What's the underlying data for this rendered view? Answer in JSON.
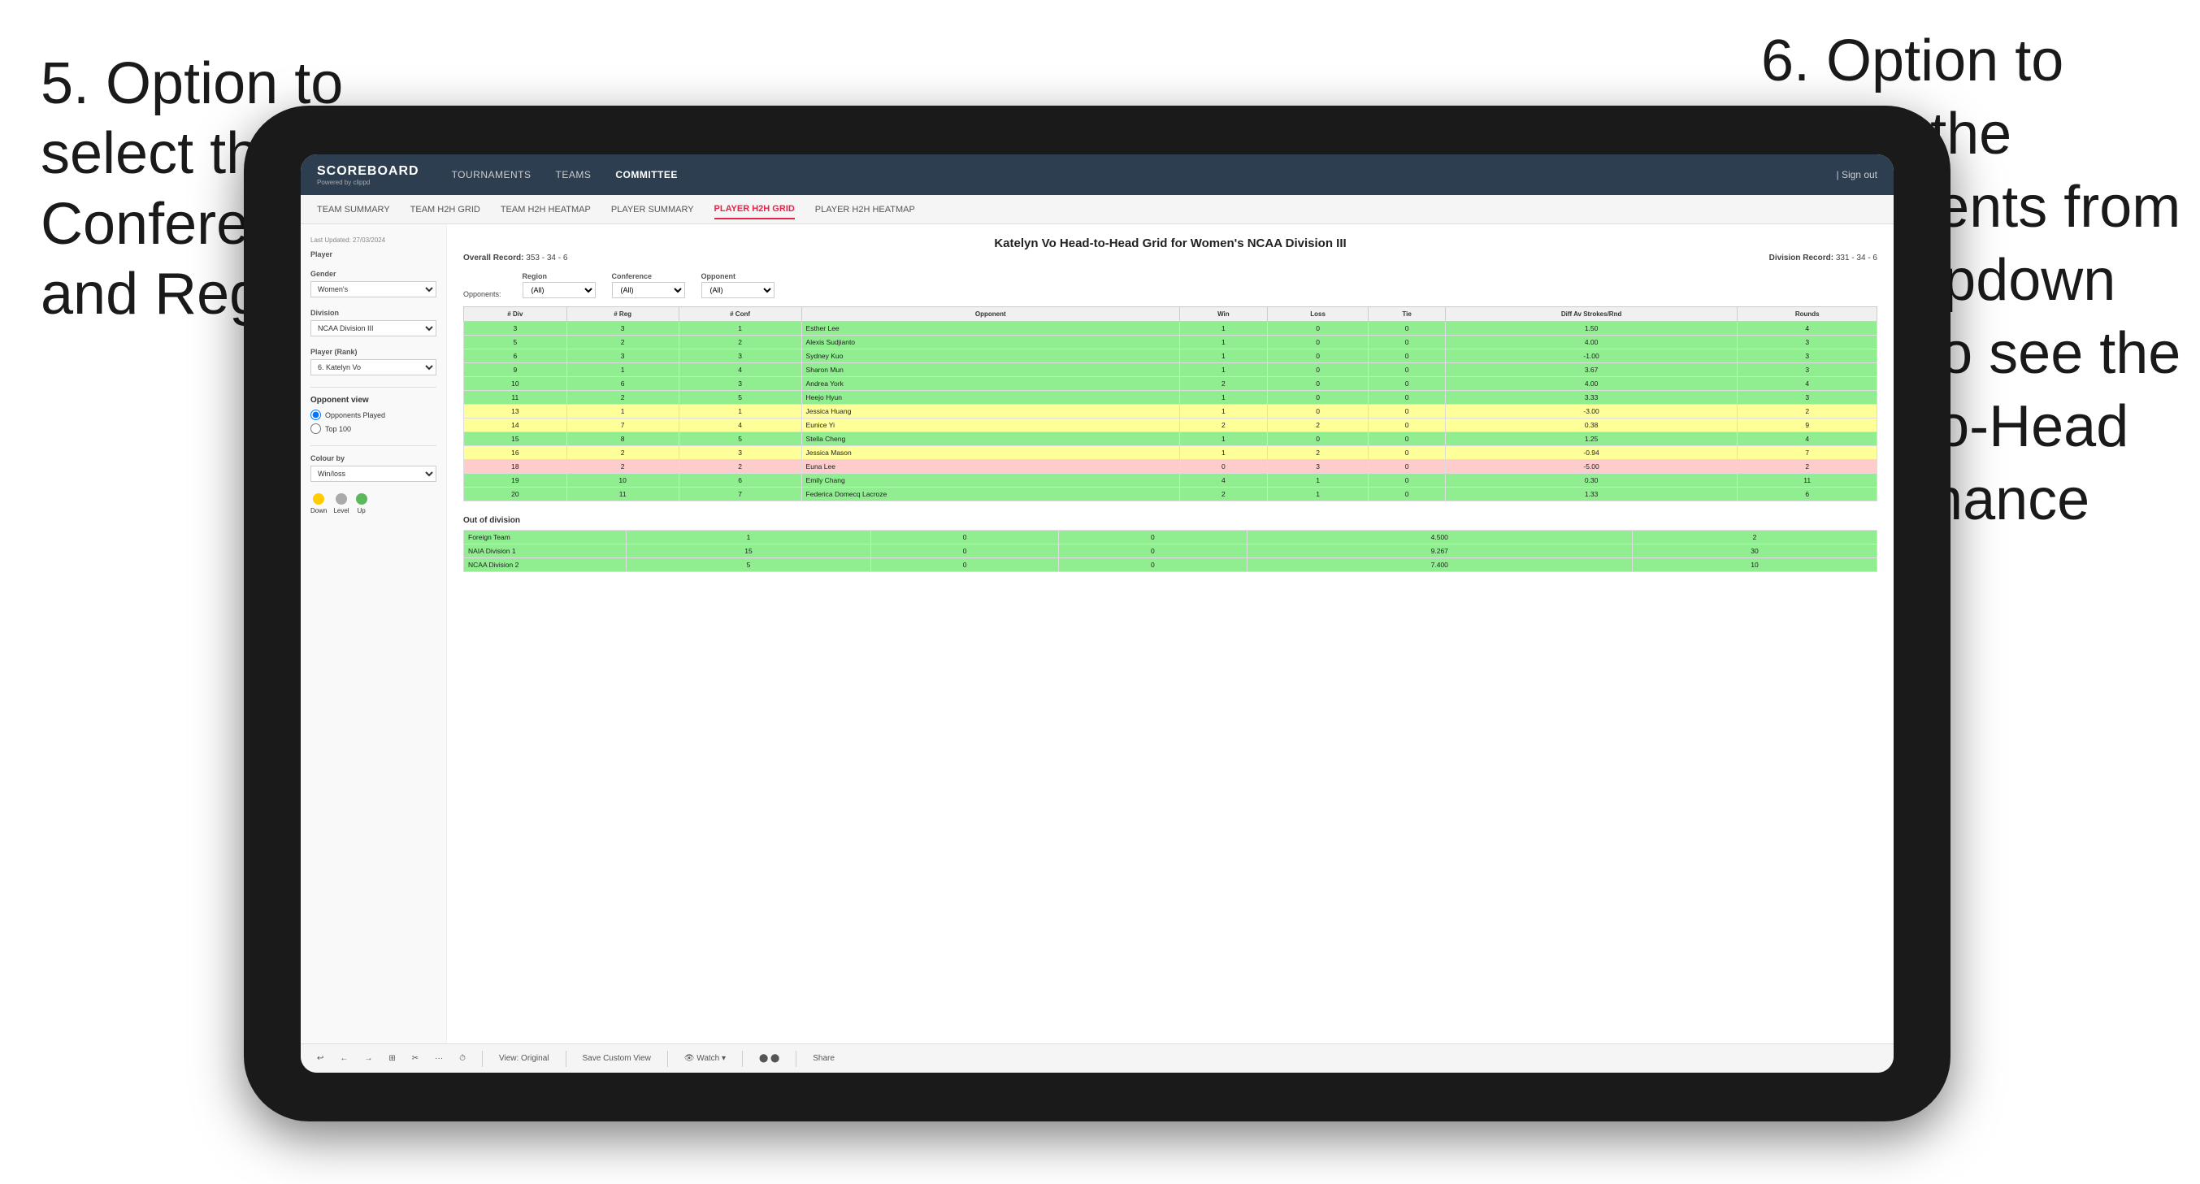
{
  "annotations": {
    "left": {
      "text": "5. Option to select the Conference and Region"
    },
    "right": {
      "text": "6. Option to select the Opponents from the dropdown menu to see the Head-to-Head performance"
    }
  },
  "nav": {
    "logo": "SCOREBOARD",
    "logo_sub": "Powered by clippd",
    "items": [
      "TOURNAMENTS",
      "TEAMS",
      "COMMITTEE"
    ],
    "active_item": "COMMITTEE",
    "sign_out": "| Sign out"
  },
  "sub_nav": {
    "items": [
      "TEAM SUMMARY",
      "TEAM H2H GRID",
      "TEAM H2H HEATMAP",
      "PLAYER SUMMARY",
      "PLAYER H2H GRID",
      "PLAYER H2H HEATMAP"
    ],
    "active": "PLAYER H2H GRID"
  },
  "left_panel": {
    "last_updated": "Last Updated: 27/03/2024",
    "player_label": "Player",
    "gender_label": "Gender",
    "gender_value": "Women's",
    "division_label": "Division",
    "division_value": "NCAA Division III",
    "player_rank_label": "Player (Rank)",
    "player_rank_value": "6. Katelyn Vo",
    "opponent_view_label": "Opponent view",
    "opponent_view_options": [
      "Opponents Played",
      "Top 100"
    ],
    "colour_by_label": "Colour by",
    "colour_by_value": "Win/loss",
    "legend_down": "Down",
    "legend_level": "Level",
    "legend_up": "Up"
  },
  "main": {
    "title": "Katelyn Vo Head-to-Head Grid for Women's NCAA Division III",
    "overall_record_label": "Overall Record:",
    "overall_record": "353 - 34 - 6",
    "division_record_label": "Division Record:",
    "division_record": "331 - 34 - 6",
    "filters": {
      "opponents_label": "Opponents:",
      "region_label": "Region",
      "region_value": "(All)",
      "conference_label": "Conference",
      "conference_value": "(All)",
      "opponent_label": "Opponent",
      "opponent_value": "(All)"
    },
    "table_headers": [
      "# Div",
      "# Reg",
      "# Conf",
      "Opponent",
      "Win",
      "Loss",
      "Tie",
      "Diff Av Strokes/Rnd",
      "Rounds"
    ],
    "table_rows": [
      {
        "div": 3,
        "reg": 3,
        "conf": 1,
        "opponent": "Esther Lee",
        "win": 1,
        "loss": 0,
        "tie": 0,
        "diff": 1.5,
        "rounds": 4,
        "color": "green"
      },
      {
        "div": 5,
        "reg": 2,
        "conf": 2,
        "opponent": "Alexis Sudjianto",
        "win": 1,
        "loss": 0,
        "tie": 0,
        "diff": 4.0,
        "rounds": 3,
        "color": "green"
      },
      {
        "div": 6,
        "reg": 3,
        "conf": 3,
        "opponent": "Sydney Kuo",
        "win": 1,
        "loss": 0,
        "tie": 0,
        "diff": -1.0,
        "rounds": 3,
        "color": "green"
      },
      {
        "div": 9,
        "reg": 1,
        "conf": 4,
        "opponent": "Sharon Mun",
        "win": 1,
        "loss": 0,
        "tie": 0,
        "diff": 3.67,
        "rounds": 3,
        "color": "green"
      },
      {
        "div": 10,
        "reg": 6,
        "conf": 3,
        "opponent": "Andrea York",
        "win": 2,
        "loss": 0,
        "tie": 0,
        "diff": 4.0,
        "rounds": 4,
        "color": "green"
      },
      {
        "div": 11,
        "reg": 2,
        "conf": 5,
        "opponent": "Heejo Hyun",
        "win": 1,
        "loss": 0,
        "tie": 0,
        "diff": 3.33,
        "rounds": 3,
        "color": "green"
      },
      {
        "div": 13,
        "reg": 1,
        "conf": 1,
        "opponent": "Jessica Huang",
        "win": 1,
        "loss": 0,
        "tie": 0,
        "diff": -3.0,
        "rounds": 2,
        "color": "yellow"
      },
      {
        "div": 14,
        "reg": 7,
        "conf": 4,
        "opponent": "Eunice Yi",
        "win": 2,
        "loss": 2,
        "tie": 0,
        "diff": 0.38,
        "rounds": 9,
        "color": "yellow"
      },
      {
        "div": 15,
        "reg": 8,
        "conf": 5,
        "opponent": "Stella Cheng",
        "win": 1,
        "loss": 0,
        "tie": 0,
        "diff": 1.25,
        "rounds": 4,
        "color": "green"
      },
      {
        "div": 16,
        "reg": 2,
        "conf": 3,
        "opponent": "Jessica Mason",
        "win": 1,
        "loss": 2,
        "tie": 0,
        "diff": -0.94,
        "rounds": 7,
        "color": "yellow"
      },
      {
        "div": 18,
        "reg": 2,
        "conf": 2,
        "opponent": "Euna Lee",
        "win": 0,
        "loss": 3,
        "tie": 0,
        "diff": -5.0,
        "rounds": 2,
        "color": "red"
      },
      {
        "div": 19,
        "reg": 10,
        "conf": 6,
        "opponent": "Emily Chang",
        "win": 4,
        "loss": 1,
        "tie": 0,
        "diff": 0.3,
        "rounds": 11,
        "color": "green"
      },
      {
        "div": 20,
        "reg": 11,
        "conf": 7,
        "opponent": "Federica Domecq Lacroze",
        "win": 2,
        "loss": 1,
        "tie": 0,
        "diff": 1.33,
        "rounds": 6,
        "color": "green"
      }
    ],
    "out_of_division": {
      "title": "Out of division",
      "rows": [
        {
          "name": "Foreign Team",
          "win": 1,
          "loss": 0,
          "tie": 0,
          "diff": 4.5,
          "rounds": 2,
          "color": "green"
        },
        {
          "name": "NAIA Division 1",
          "win": 15,
          "loss": 0,
          "tie": 0,
          "diff": 9.267,
          "rounds": 30,
          "color": "green"
        },
        {
          "name": "NCAA Division 2",
          "win": 5,
          "loss": 0,
          "tie": 0,
          "diff": 7.4,
          "rounds": 10,
          "color": "green"
        }
      ]
    }
  },
  "toolbar": {
    "items": [
      "↩",
      "←",
      "→",
      "⊞",
      "✂",
      "·",
      "⏱",
      "|",
      "View: Original",
      "|",
      "Save Custom View",
      "|",
      "👁 Watch ▾",
      "|",
      "⬤ ⬤",
      "|",
      "Share"
    ]
  }
}
